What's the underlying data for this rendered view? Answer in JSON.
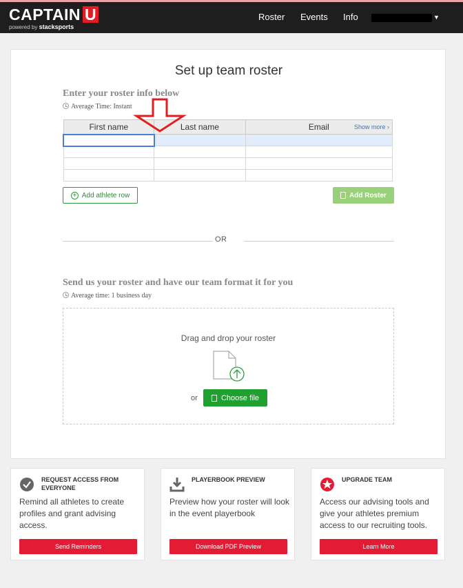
{
  "app": {
    "logo_main": "CAPTAIN",
    "logo_u": "U",
    "logo_powered": "powered by",
    "logo_brand": "stacksports"
  },
  "nav": {
    "items": [
      "Roster",
      "Events",
      "Info"
    ],
    "user_redacted": true
  },
  "setup": {
    "title": "Set up team roster",
    "enter_heading": "Enter your roster info below",
    "avg_time_1": "Average Time: Instant",
    "columns": [
      "First name",
      "Last name",
      "Email"
    ],
    "show_more": "Show more",
    "add_row_button": "Add athlete row",
    "add_roster_button": "Add Roster",
    "or": "OR",
    "send_heading": "Send us your roster and have our team format it for you",
    "avg_time_2": "Average time: 1 business day",
    "drag_drop": "Drag and drop your roster",
    "or_small": "or",
    "choose_file": "Choose file"
  },
  "tiles": [
    {
      "title": "REQUEST ACCESS FROM EVERYONE",
      "body": "Remind all athletes to create profiles and grant advising access.",
      "button": "Send Reminders",
      "icon": "check-circle-icon"
    },
    {
      "title": "PLAYERBOOK PREVIEW",
      "body": "Preview how your roster will look in the event playerbook",
      "button": "Download PDF Preview",
      "icon": "download-icon"
    },
    {
      "title": "UPGRADE TEAM",
      "body": "Access our advising tools and give your athletes premium access to our recruiting tools.",
      "button": "Learn More",
      "icon": "star-badge-icon"
    }
  ],
  "colors": {
    "accent_red": "#e31b34",
    "green": "#1fa02f",
    "light_green": "#9bd07a",
    "nav_bg": "#1e1e1e"
  }
}
